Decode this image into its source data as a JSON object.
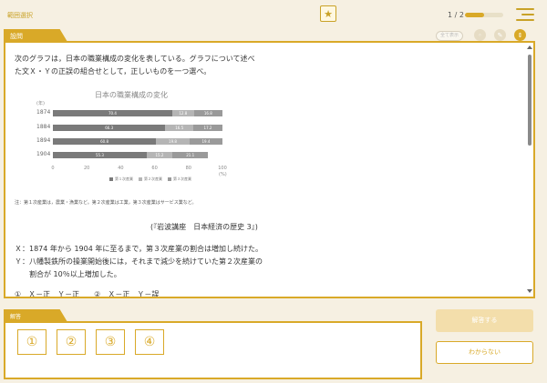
{
  "header": {
    "breadcrumb": "範囲選択",
    "progress_text": "1 / 2",
    "progress_fraction": 0.5,
    "bookmark_icon": "star-icon",
    "menu_icon": "menu-icon"
  },
  "question": {
    "tab_label": "設問",
    "tool_button_label": "全て表示",
    "text_lines": [
      "次のグラフは，日本の職業構成の変化を表している。グラフについて述べ",
      "た文Ｘ・Ｙの正誤の組合せとして，正しいものを一つ選べ。"
    ],
    "note": "注：第１次産業は，農業・漁業など。第２次産業は工業，第３次産業はサービス業など。",
    "source": "(『岩波講座　日本経済の歴史 3』)",
    "statements": [
      "Ｘ：1874 年から 1904 年に至るまで，第３次産業の割合は増加し続けた。",
      "Ｙ：八幡製鉄所の操業開始後には，それまで減少を続けていた第２次産業の",
      "　　割合が 10％以上増加した。"
    ],
    "options_row": "①　Ｘ－正　Ｙ－正　　②　Ｘ－正　Ｙ－誤"
  },
  "chart_data": {
    "type": "bar",
    "orientation": "horizontal-stacked",
    "title": "日本の職業構成の変化",
    "ylabel": "(年)",
    "xlabel": "(%)",
    "categories": [
      "1874",
      "1884",
      "1894",
      "1904"
    ],
    "x_ticks": [
      "0",
      "20",
      "40",
      "60",
      "80",
      "100"
    ],
    "xlim": [
      0,
      100
    ],
    "series": [
      {
        "name": "第１次産業",
        "color": "#7a7a7a",
        "values": [
          70.4,
          66.3,
          60.8,
          55.3
        ]
      },
      {
        "name": "第２次産業",
        "color": "#b5b5b5",
        "values": [
          12.8,
          16.5,
          19.8,
          15.2
        ]
      },
      {
        "name": "第３次産業",
        "color": "#9a9a9a",
        "values": [
          16.8,
          17.2,
          19.4,
          21.1
        ]
      }
    ]
  },
  "answer": {
    "tab_label": "解答",
    "choices": [
      "①",
      "②",
      "③",
      "④"
    ],
    "submit_label": "解答する",
    "unknown_label": "わからない"
  }
}
